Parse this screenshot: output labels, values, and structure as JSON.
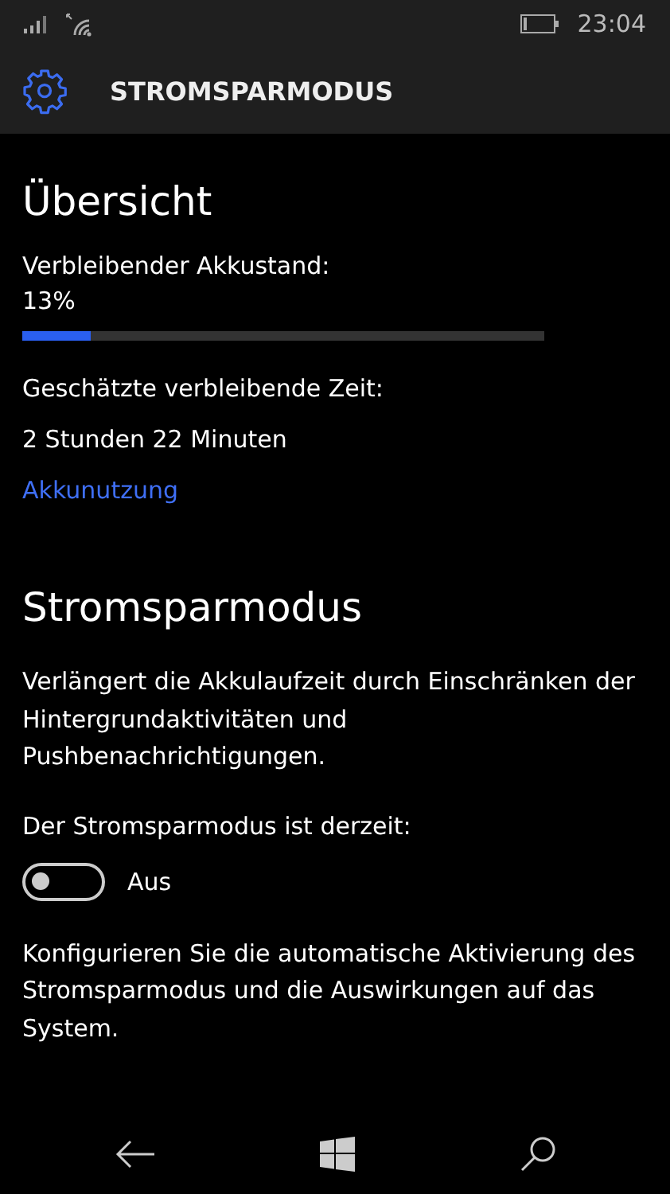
{
  "status_bar": {
    "time": "23:04"
  },
  "header": {
    "title": "STROMSPARMODUS"
  },
  "overview": {
    "heading": "Übersicht",
    "battery_label": "Verbleibender Akkustand:",
    "battery_value": "13%",
    "battery": {
      "level": 0.13
    },
    "time_label": "Geschätzte verbleibende Zeit:",
    "time_value": "2 Stunden 22 Minuten",
    "link": "Akkunutzung"
  },
  "saver": {
    "heading": "Stromsparmodus",
    "description": "Verlängert die Akkulaufzeit durch Einschränken der Hintergrundaktivitäten und Pushbenachrichtigungen.",
    "state_label": "Der Stromsparmodus ist derzeit:",
    "toggle": {
      "on": false,
      "label": "Aus"
    },
    "config_text": "Konfigurieren Sie die automatische Aktivierung des Stromsparmodus und die Auswirkungen auf das System."
  }
}
